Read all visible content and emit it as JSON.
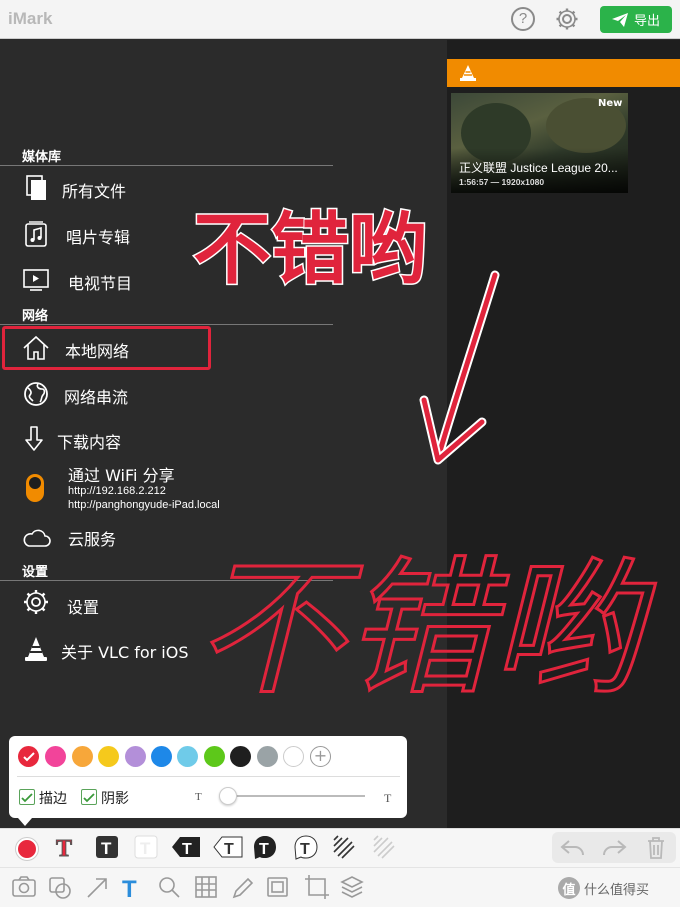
{
  "titlebar": {
    "app_title": "iMark",
    "help_glyph": "?",
    "export_label": "导出",
    "gear_icon": "gear-icon"
  },
  "vlc_panel": {
    "new_badge": "New",
    "movie_title": "正义联盟 Justice League 20...",
    "movie_meta": "1:56:57 — 1920x1080",
    "accent": "#f18b00"
  },
  "sidebar": {
    "section_media": "媒体库",
    "item_all_files": "所有文件",
    "item_albums": "唱片专辑",
    "item_tv": "电视节目",
    "section_network": "网络",
    "item_local_network": "本地网络",
    "item_streaming": "网络串流",
    "item_downloads": "下载内容",
    "item_wifi": "通过 WiFi 分享",
    "wifi_url_ip": "http://192.168.2.212",
    "wifi_url_host": "http://panghongyude-iPad.local",
    "item_cloud": "云服务",
    "section_settings": "设置",
    "item_settings": "设置",
    "item_about": "关于 VLC for iOS"
  },
  "annotations": {
    "typed_text": "不错哟",
    "handwritten_text": "不错哟",
    "color": "#e0243c"
  },
  "palette": {
    "swatches": [
      "#e8283d",
      "#f2449a",
      "#f7a73a",
      "#f5c91c",
      "#b38fd9",
      "#1e88e8",
      "#6fcbe9",
      "#5dc81a",
      "#1f1f1f",
      "#9aa3a6",
      "#ffffff"
    ],
    "stroke_label": "描边",
    "shadow_label": "阴影",
    "size_small": "T",
    "size_large": "T",
    "add_glyph": "+"
  },
  "toolbar": {
    "text_glyph": "T"
  },
  "watermark": {
    "logo": "值",
    "text": "什么值得买"
  }
}
